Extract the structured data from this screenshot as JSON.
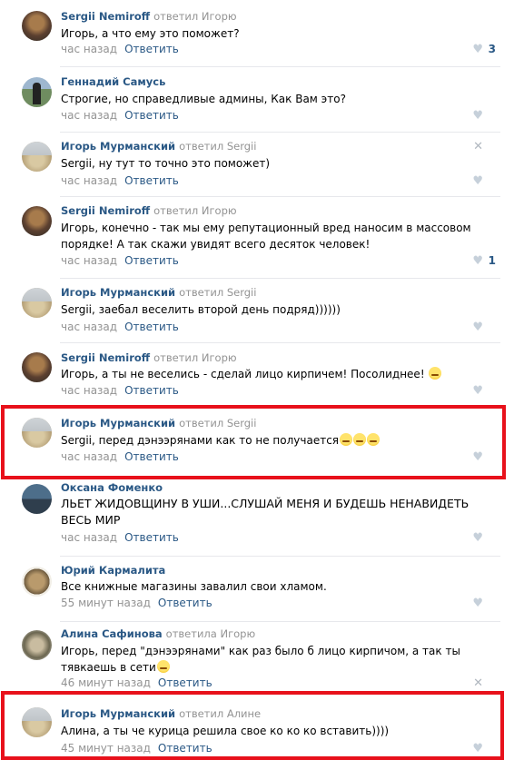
{
  "like_icon": "heart-icon",
  "close_icon": "close-icon",
  "comments": [
    {
      "author": "Sergii Nemiroff",
      "reply_to": "ответил Игорю",
      "text": "Игорь, а что ему это поможет?",
      "time": "час назад",
      "reply": "Ответить",
      "likes": "3"
    },
    {
      "author": "Геннадий Самусь",
      "reply_to": "",
      "text": "Строгие, но справедливые админы, Как Вам это?",
      "time": "час назад",
      "reply": "Ответить",
      "likes": ""
    },
    {
      "author": "Игорь Мурманский",
      "reply_to": "ответил Sergii",
      "text": "Sergii, ну тут то точно это поможет)",
      "time": "час назад",
      "reply": "Ответить",
      "likes": ""
    },
    {
      "author": "Sergii Nemiroff",
      "reply_to": "ответил Игорю",
      "text": "Игорь, конечно - так мы ему репутационный вред наносим в массовом порядке! А так скажи увидят всего десяток человек!",
      "time": "час назад",
      "reply": "Ответить",
      "likes": "1"
    },
    {
      "author": "Игорь Мурманский",
      "reply_to": "ответил Sergii",
      "text": "Sergii, заебал веселить второй день подряд))))))",
      "time": "час назад",
      "reply": "Ответить",
      "likes": ""
    },
    {
      "author": "Sergii Nemiroff",
      "reply_to": "ответил Игорю",
      "text": "Игорь, а ты не веселись - сделай лицо кирпичем! Посолиднее!",
      "time": "час назад",
      "reply": "Ответить",
      "likes": ""
    },
    {
      "author": "Игорь Мурманский",
      "reply_to": "ответил Sergii",
      "text": "Sergii, перед дэнээрянами как то не получается",
      "time": "час назад",
      "reply": "Ответить",
      "likes": ""
    },
    {
      "author": "Оксана Фоменко",
      "reply_to": "",
      "text": "ЛЬЕТ ЖИДОВЩИНУ В УШИ...СЛУШАЙ МЕНЯ И БУДЕШЬ НЕНАВИДЕТЬ ВЕСЬ МИР",
      "time": "час назад",
      "reply": "Ответить",
      "likes": ""
    },
    {
      "author": "Юрий Кармалита",
      "reply_to": "",
      "text": "Все книжные магазины завалил свои хламом.",
      "time": "55 минут назад",
      "reply": "Ответить",
      "likes": ""
    },
    {
      "author": "Алина Сафинова",
      "reply_to": "ответила Игорю",
      "text": "Игорь, перед \"дэнээрянами\" как раз было б лицо кирпичом, а так ты тявкаешь в сети",
      "time": "46 минут назад",
      "reply": "Ответить",
      "likes": ""
    },
    {
      "author": "Игорь Мурманский",
      "reply_to": "ответил Алине",
      "text": "Алина, а ты че курица решила свое ко ко ко вставить))))",
      "time": "45 минут назад",
      "reply": "Ответить",
      "likes": ""
    }
  ]
}
